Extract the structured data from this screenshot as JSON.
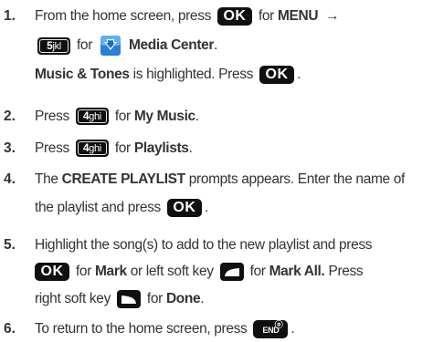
{
  "steps": [
    {
      "num": "1.",
      "lines": [
        [
          "From the home screen, press",
          "OK",
          "for",
          "MENU",
          "→"
        ],
        [
          "5jkl",
          "for",
          "Media Center",
          "."
        ],
        [
          "Music & Tones",
          "is highlighted. Press",
          "OK",
          "."
        ]
      ]
    },
    {
      "num": "2.",
      "a": "Press",
      "key": "4ghi",
      "b": "for",
      "c": "My Music",
      "d": "."
    },
    {
      "num": "3.",
      "a": "Press",
      "key": "4ghi",
      "b": "for",
      "c": "Playlists",
      "d": "."
    },
    {
      "num": "4.",
      "l1a": "The",
      "l1b": "CREATE PLAYLIST",
      "l1c": "prompts appears. Enter the name of",
      "l2a": "the playlist and press",
      "l2key": "OK",
      "l2b": "."
    },
    {
      "num": "5.",
      "l1": "Highlight the song(s) to add to the new playlist and press",
      "l2key": "OK",
      "l2a": "for",
      "l2b": "Mark",
      "l2c": "or left soft key",
      "l2d": "for",
      "l2e": "Mark All.",
      "l2f": "Press",
      "l3a": "right soft key",
      "l3b": "for",
      "l3c": "Done",
      "l3d": "."
    },
    {
      "num": "6.",
      "a": "To return to the home screen, press",
      "key": "END",
      "d": "."
    }
  ],
  "keys": {
    "ok": "OK",
    "digit5": "5",
    "letters5": "jkl",
    "digit4": "4",
    "letters4": "ghi",
    "end": "END",
    "power": "ⓞ"
  },
  "icons": {
    "media": "media-center-icon",
    "softkey_left": "left-softkey-icon",
    "softkey_right": "right-softkey-icon"
  },
  "colors": {
    "text": "#333333",
    "key_bg": "#101010",
    "icon_blue": "#1f6fc4"
  }
}
